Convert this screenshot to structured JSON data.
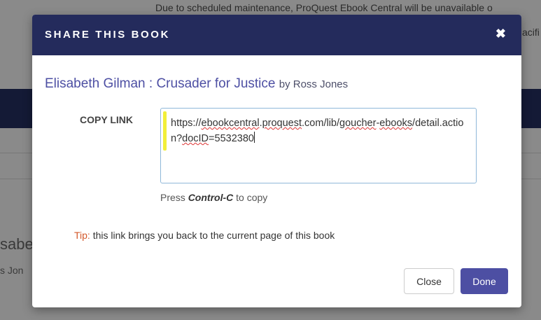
{
  "background": {
    "banner": "Due to scheduled maintenance, ProQuest Ebook Central will be unavailable o",
    "banner_right": "acifi",
    "partial_title": "sabe",
    "partial_author": "s Jon"
  },
  "modal": {
    "title": "SHARE THIS BOOK",
    "close_icon": "✖",
    "book_title": "Elisabeth Gilman : Crusader for Justice",
    "book_by": "by Ross Jones",
    "copy_label": "COPY LINK",
    "link_part1": "https://",
    "link_sq1": "ebookcentral",
    "link_part2": ".",
    "link_sq2": "proquest",
    "link_part3": ".com/lib/",
    "link_sq3": "goucher",
    "link_part4": "-",
    "link_sq4": "ebooks",
    "link_part5": "/detail.action?",
    "link_sq5": "docID",
    "link_part6": "=5532380",
    "press_prefix": "Press ",
    "press_key": "Control-C",
    "press_suffix": " to copy",
    "tip_label": "Tip:",
    "tip_text": " this link brings you back to the current page of this book",
    "close_button": "Close",
    "done_button": "Done"
  },
  "colors": {
    "header_bg": "#242b5c",
    "accent": "#4d4fa3",
    "tip": "#d3582a",
    "highlight": "#f2ef3a"
  }
}
